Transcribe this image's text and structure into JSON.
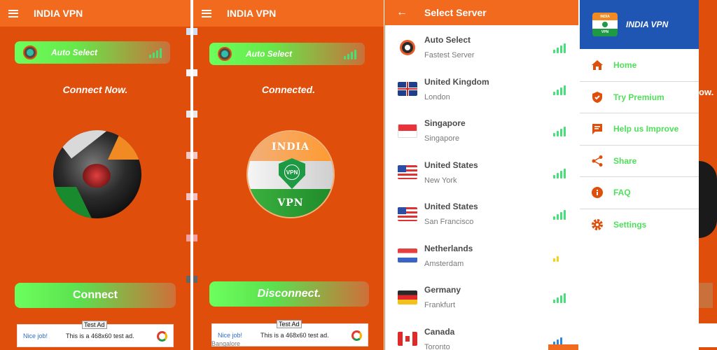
{
  "app_title": "INDIA VPN",
  "home1": {
    "auto_select": "Auto Select",
    "status": "Connect Now.",
    "button": "Connect",
    "ad": {
      "tag": "Test Ad",
      "nice": "Nice job!",
      "text": "This is a 468x60 test ad."
    }
  },
  "home2": {
    "auto_select": "Auto Select",
    "status": "Connected.",
    "logo_top": "INDIA",
    "logo_bottom": "VPN",
    "shield_text": "VPN",
    "button": "Disconnect.",
    "ad": {
      "tag": "Test Ad",
      "nice": "Nice job!",
      "text": "This is a 468x60 test ad."
    },
    "peek": "Bangalore"
  },
  "server_list": {
    "title": "Select Server",
    "rows": [
      {
        "country": "Auto Select",
        "city": "Fastest Server",
        "icon": "auto-select-icon",
        "signal": 4,
        "signal_color": "#46e07a"
      },
      {
        "country": "United Kingdom",
        "city": "London",
        "icon": "uk-flag-icon",
        "signal": 4,
        "signal_color": "#46e07a"
      },
      {
        "country": "Singapore",
        "city": "Singapore",
        "icon": "singapore-flag-icon",
        "signal": 4,
        "signal_color": "#46e07a"
      },
      {
        "country": "United States",
        "city": "New York",
        "icon": "us-flag-icon",
        "signal": 4,
        "signal_color": "#46e07a"
      },
      {
        "country": "United States",
        "city": "San Francisco",
        "icon": "us-flag-icon",
        "signal": 4,
        "signal_color": "#46e07a"
      },
      {
        "country": "Netherlands",
        "city": "Amsterdam",
        "icon": "netherlands-flag-icon",
        "signal": 2,
        "signal_color": "#f2d21b"
      },
      {
        "country": "Germany",
        "city": "Frankfurt",
        "icon": "germany-flag-icon",
        "signal": 4,
        "signal_color": "#46e07a"
      },
      {
        "country": "Canada",
        "city": "Toronto",
        "icon": "canada-flag-icon",
        "signal": 3,
        "signal_color": "#2b86e0"
      }
    ]
  },
  "drawer": {
    "title": "INDIA VPN",
    "badge_top": "INDIA",
    "badge_bottom": "VPN",
    "items": [
      {
        "label": "Home",
        "icon": "home-icon"
      },
      {
        "label": "Try Premium",
        "icon": "premium-shield-icon"
      },
      {
        "label": "Help us Improve",
        "icon": "feedback-icon"
      },
      {
        "label": "Share",
        "icon": "share-icon"
      },
      {
        "label": "FAQ",
        "icon": "info-icon"
      },
      {
        "label": "Settings",
        "icon": "settings-gear-icon"
      }
    ],
    "behind_text": "ow."
  },
  "colors": {
    "accent": "#e04e0b",
    "appbar": "#f26a1e",
    "drawer_head": "#1f56b4",
    "menu_text": "#4fe05a",
    "menu_icon": "#e04e0b"
  }
}
